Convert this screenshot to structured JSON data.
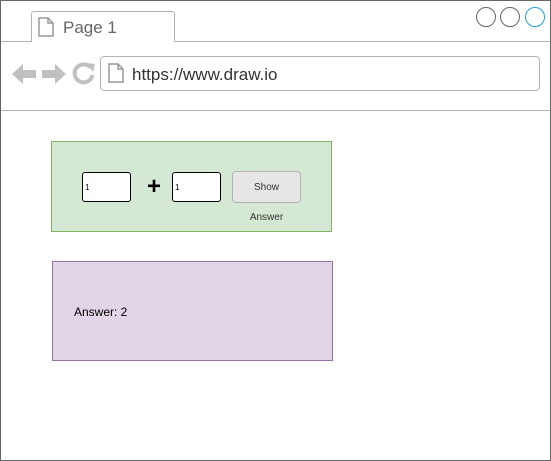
{
  "browser": {
    "tab_title": "Page 1",
    "url": "https://www.draw.io"
  },
  "calculator": {
    "operand_a": "1",
    "operator": "+",
    "operand_b": "1",
    "show_answer_label": "Show Answer",
    "answer_text": "Answer: 2"
  },
  "colors": {
    "input_panel_fill": "#d5e8d4",
    "input_panel_border": "#82b366",
    "answer_panel_fill": "#e1d5e7",
    "answer_panel_border": "#9673a6",
    "maximize_accent": "#1ba1e2"
  },
  "icons": {
    "tab": "page-icon",
    "back": "back-arrow-icon",
    "forward": "forward-arrow-icon",
    "reload": "reload-icon",
    "url": "page-icon"
  }
}
